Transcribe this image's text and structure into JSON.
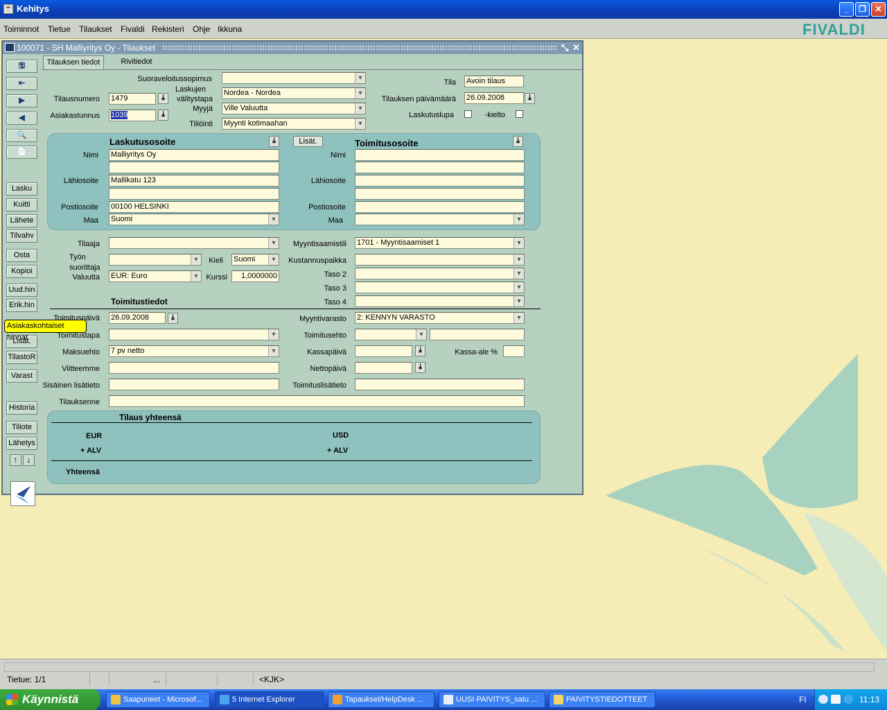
{
  "app": {
    "title": "Kehitys",
    "brand": "FIVALDI"
  },
  "menu": [
    "Toiminnot",
    "Tietue",
    "Tilaukset",
    "Fivaldi",
    "Rekisteri",
    "Ohje",
    "Ikkuna"
  ],
  "form": {
    "title": "100071 - SH Malliyritys Oy - Tilaukset",
    "tabs": [
      "Tilauksen tiedot",
      "Rivitiedot"
    ],
    "toolbar": [
      "Lasku",
      "Kuitti",
      "Lähete",
      "Tilvahv",
      "Osta",
      "Kopioi",
      "Uud.hin",
      "Erik.hin",
      "Lisät.",
      "TilastoR",
      "Varast",
      "Historia",
      "Tiliote",
      "Lähetys"
    ],
    "tooltip": "Asiakaskohtaiset hinnat",
    "labels": {
      "suoraveloitus": "Suoraveloitussopimus",
      "laskujen": "Laskujen",
      "valitystapa": "välitystapa",
      "myyja": "Myyjä",
      "tiliointi": "Tiliöinti",
      "tilausnumero": "Tilausnumero",
      "asiakastunnus": "Asiakastunnus",
      "tila": "Tila",
      "paivamaara": "Tilauksen päivämäärä",
      "laskutuslupa": "Laskutuslupa",
      "kielto": "-kielto",
      "nimi": "Nimi",
      "lahiosoite": "Lähiosoite",
      "postiosoite": "Postiosoite",
      "maa": "Maa",
      "tilaaja": "Tilaaja",
      "tyon1": "Työn",
      "tyon2": "suorittaja",
      "valuutta": "Valuutta",
      "kieli": "Kieli",
      "kurssi": "Kurssi",
      "myyntisaamistili": "Myyntisaamistili",
      "kustannuspaikka": "Kustannuspaikka",
      "taso2": "Taso 2",
      "taso3": "Taso 3",
      "taso4": "Taso 4",
      "toimituspaiva": "Toimituspäivä",
      "toimitustapa": "Toimitustapa",
      "maksuehto": "Maksuehto",
      "viitteemme": "Viitteemme",
      "sisainen": "Sisäinen lisätieto",
      "tilauksenne": "Tilauksenne",
      "myyntivarasto": "Myyntivarasto",
      "toimitusehto": "Toimitusehto",
      "kassapaiva": "Kassapäivä",
      "kassaale": "Kassa-ale %",
      "nettopaiva": "Nettopäivä",
      "toimituslisatieto": "Toimituslisätieto"
    },
    "values": {
      "suoraveloitus": "",
      "valitystapa": "Nordea - Nordea",
      "myyja": "Ville Valuutta",
      "tiliointi": "Myynti kotimaahan",
      "tilausnumero": "1479",
      "asiakastunnus": "1039",
      "tila": "Avoin tilaus",
      "paivamaara": "26.09.2008",
      "valuutta": "EUR: Euro",
      "kieli": "Suomi",
      "kurssi": "1,0000000",
      "myyntisaamistili": "1701 - Myyntisaamiset 1",
      "toimituspaiva": "26.09.2008",
      "maksuehto": "7 pv netto",
      "myyntivarasto": "2: KENNYN VARASTO"
    },
    "billing": {
      "title": "Laskutusosoite",
      "nimi": "Malliyritys Oy",
      "lahiosoite": "Mallikatu 123",
      "postiosoite": "00100  HELSINKI",
      "maa": "Suomi"
    },
    "shipping": {
      "title": "Toimitusosoite",
      "lisat_button": "Lisät."
    },
    "delivery_title": "Toimitustiedot",
    "totals": {
      "title": "Tilaus yhteensä",
      "eur": "EUR",
      "usd": "USD",
      "alv1": "+ ALV",
      "alv2": "+ ALV",
      "yhteensa": "Yhteensä"
    }
  },
  "status": {
    "record": "Tietue: 1/1",
    "dots": "...",
    "mode": "<KJK>"
  },
  "taskbar": {
    "start": "Käynnistä",
    "tasks": [
      "Saapuneet - Microsof...",
      "5 Internet Explorer",
      "Tapaukset/HelpDesk ...",
      "UUSI PAIVITYS_satu ...",
      "PAIVITYSTIEDOTTEET"
    ],
    "lang": "FI",
    "time": "11:13"
  }
}
